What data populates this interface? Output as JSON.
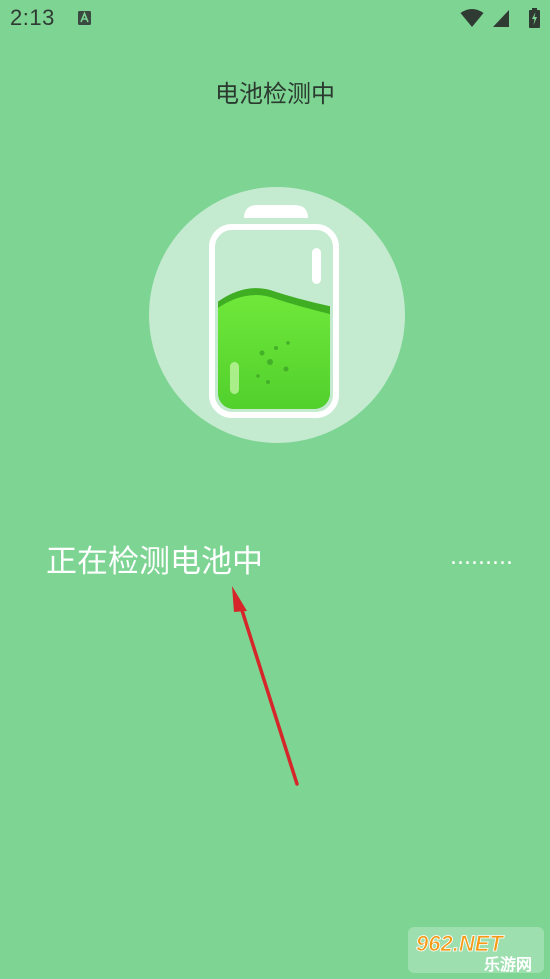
{
  "status_bar": {
    "time": "2:13",
    "notification_icon": "a-badge-icon",
    "wifi_icon": "wifi-icon",
    "signal_icon": "cell-signal-icon",
    "battery_icon": "battery-charging-icon"
  },
  "header": {
    "title": "电池检测中"
  },
  "battery_graphic": {
    "icon": "battery-level-icon",
    "fill_level": 0.55,
    "liquid_color": "#66e134",
    "circle_color": "#c4ead0"
  },
  "detection": {
    "message": "正在检测电池中",
    "dots": "........."
  },
  "annotation": {
    "icon": "red-arrow-icon",
    "color": "#d6262a"
  },
  "watermark": {
    "text_top": "962.NET",
    "text_bottom": "乐游网"
  },
  "colors": {
    "background": "#7dd493"
  }
}
